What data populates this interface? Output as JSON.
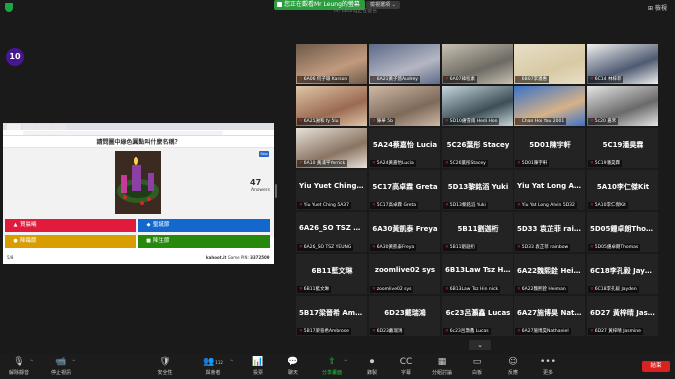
{
  "topbar": {
    "share_status": "您正在觀看Mr Leung的螢幕",
    "under_text": "Mr Leung正在發言",
    "view_options": "檢視選項 ⌄",
    "view_button": "⊞ 檢視"
  },
  "kahoot": {
    "question": "請問圖中綠色圓點叫什麼名稱？",
    "timer": "10",
    "answers_count": "47",
    "answers_label": "Answers",
    "skip": "Skip",
    "options": [
      {
        "label": "賀晨曦",
        "color": "#e21b3c",
        "symbol": "▲"
      },
      {
        "label": "聖誕節",
        "color": "#1368ce",
        "symbol": "◆"
      },
      {
        "label": "降臨節",
        "color": "#d89e00",
        "symbol": "●"
      },
      {
        "label": "降生節",
        "color": "#26890c",
        "symbol": "■"
      }
    ],
    "page": "5/8",
    "site": "kahoot.it",
    "pin_label": "Game PIN:",
    "pin": "3372509"
  },
  "gallery": {
    "tiles": [
      {
        "name": "6A06 何子瑜 Karson",
        "big": "",
        "video": "#c29a7e",
        "video2": "#6d5a4a"
      },
      {
        "name": "6A21黃子悠Audrey",
        "big": "",
        "video": "#b5b7c2",
        "video2": "#5d6a8a"
      },
      {
        "name": "6A07韓程素",
        "big": "",
        "video": "#6d6a63",
        "video2": "#c8c1b3"
      },
      {
        "name": "6B07李潘惠",
        "big": "",
        "video": "#d8c9a4",
        "video2": "#e8dfc8"
      },
      {
        "name": "6C14 林梓菲",
        "big": "",
        "video": "#4e5a72",
        "video2": "#f0f0ee"
      },
      {
        "name": "6A25謝和 fy 5lu",
        "big": "",
        "video": "#9a6a52",
        "video2": "#e0c6a8"
      },
      {
        "name": "陳華 5b",
        "big": "",
        "video": "#7d6a5a",
        "video2": "#d0b8a6"
      },
      {
        "name": "SD10鍾雪雨 Hedi Hon",
        "big": "",
        "video": "#3e4e56",
        "video2": "#c6d6dc"
      },
      {
        "name": "Chan Hoi Yau 2001",
        "big": "",
        "video": "#d6b288",
        "video2": "#3a72c8"
      },
      {
        "name": "5c20 嘉禾",
        "big": "",
        "video": "#6a6a6a",
        "video2": "#e6e6e6"
      },
      {
        "name": "6A10 黃浦平Yerrick",
        "big": "",
        "video": "#8a7462",
        "video2": "#e8e2da"
      },
      {
        "name": "5A24黃嘉怡Lucia",
        "big": "5A24蔡嘉怡 Lucia",
        "video": "",
        "video2": ""
      },
      {
        "name": "5C26葉彤Stacey",
        "big": "5C26葉彤 Stacey",
        "video": "",
        "video2": ""
      },
      {
        "name": "5D01陳宇軒",
        "big": "5D01陳宇軒",
        "video": "",
        "video2": ""
      },
      {
        "name": "5C19潘昊霖",
        "big": "5C19潘昊霖",
        "video": "",
        "video2": ""
      },
      {
        "name": "Yiu Yuet Ching 5A37",
        "big": "Yiu Yuet Ching 5A37",
        "video": "",
        "video2": ""
      },
      {
        "name": "5C17高卓霖 Greta",
        "big": "5C17高卓霖 Greta",
        "video": "",
        "video2": ""
      },
      {
        "name": "5D13黎銘滔 Yuki",
        "big": "5D13黎銘滔 Yuki",
        "video": "",
        "video2": ""
      },
      {
        "name": "Yiu Yat Long Alvin 5D32",
        "big": "Yiu Yat Long Alvin 5D32",
        "video": "",
        "video2": ""
      },
      {
        "name": "5A10李仁傑Kit",
        "big": "5A10李仁傑Kit",
        "video": "",
        "video2": ""
      },
      {
        "name": "6A26_SO TSZ YEUNG",
        "big": "6A26_SO TSZ YEUNG",
        "video": "",
        "video2": ""
      },
      {
        "name": "6A30黃凱泰Freya",
        "big": "6A30黃凱泰 Freya",
        "video": "",
        "video2": ""
      },
      {
        "name": "5B11劉迦桁",
        "big": "5B11劉迦桁",
        "video": "",
        "video2": ""
      },
      {
        "name": "5D33 袁芷菲 rainbow",
        "big": "5D33 袁芷菲 rainbow",
        "video": "",
        "video2": ""
      },
      {
        "name": "5D05鍾卓朗Thomas",
        "big": "5D05鍾卓朗Thomas",
        "video": "",
        "video2": ""
      },
      {
        "name": "6B11藍文琳",
        "big": "6B11藍文琳",
        "video": "",
        "video2": ""
      },
      {
        "name": "zoomlive02 sys",
        "big": "zoomlive02 sys",
        "video": "",
        "video2": ""
      },
      {
        "name": "6B13Law Tsz Hin nick",
        "big": "6B13Law Tsz Hin nick",
        "video": "",
        "video2": ""
      },
      {
        "name": "6A22魏熙銓 Heiman",
        "big": "6A22魏熙銓 Heiman",
        "video": "",
        "video2": ""
      },
      {
        "name": "6C18李孔毅 Jayden",
        "big": "6C18李孔毅 Jayden",
        "video": "",
        "video2": ""
      },
      {
        "name": "5B17梁晉希Ambrose",
        "big": "5B17梁晉希 Ambrose",
        "video": "",
        "video2": ""
      },
      {
        "name": "6D23戴瑞鴻",
        "big": "6D23戴瑞鴻",
        "video": "",
        "video2": ""
      },
      {
        "name": "6c23呂灝鑫 Lucas",
        "big": "6c23呂灝鑫 Lucas",
        "video": "",
        "video2": ""
      },
      {
        "name": "6A27施博昊Nathaniel",
        "big": "6A27施博昊 Nathaniel",
        "video": "",
        "video2": ""
      },
      {
        "name": "6D27 黃梓晴 Jasmine",
        "big": "6D27 黃梓晴 Jasmine",
        "video": "",
        "video2": ""
      }
    ]
  },
  "toolbar": {
    "items": [
      {
        "icon": "🎙",
        "label": "解除靜音",
        "name": "unmute-button",
        "green": false,
        "badge": ""
      },
      {
        "icon": "📹",
        "label": "停止視訊",
        "name": "stop-video-button",
        "green": false,
        "badge": ""
      },
      {
        "icon": "🛡",
        "label": "安全性",
        "name": "security-button",
        "green": false,
        "badge": ""
      },
      {
        "icon": "👥",
        "label": "與會者",
        "name": "participants-button",
        "green": false,
        "badge": "112"
      },
      {
        "icon": "📊",
        "label": "投票",
        "name": "polls-button",
        "green": false,
        "badge": ""
      },
      {
        "icon": "💬",
        "label": "聊天",
        "name": "chat-button",
        "green": false,
        "badge": ""
      },
      {
        "icon": "⇧",
        "label": "分享畫面",
        "name": "share-screen-button",
        "green": true,
        "badge": ""
      },
      {
        "icon": "⏺",
        "label": "錄製",
        "name": "record-button",
        "green": false,
        "badge": ""
      },
      {
        "icon": "CC",
        "label": "字幕",
        "name": "captions-button",
        "green": false,
        "badge": ""
      },
      {
        "icon": "▦",
        "label": "分組討論",
        "name": "breakout-rooms-button",
        "green": false,
        "badge": ""
      },
      {
        "icon": "▭",
        "label": "白板",
        "name": "whiteboard-button",
        "green": false,
        "badge": ""
      },
      {
        "icon": "☺",
        "label": "反應",
        "name": "reactions-button",
        "green": false,
        "badge": ""
      },
      {
        "icon": "•••",
        "label": "更多",
        "name": "more-button",
        "green": false,
        "badge": ""
      }
    ],
    "end": "結束"
  },
  "colors": {
    "background": "#1a1a1a",
    "tile": "#232323",
    "kahoot_purple": "#46178f",
    "share_green": "#2c9d3e",
    "end_red": "#d7221f",
    "muted_red": "#e02828"
  }
}
